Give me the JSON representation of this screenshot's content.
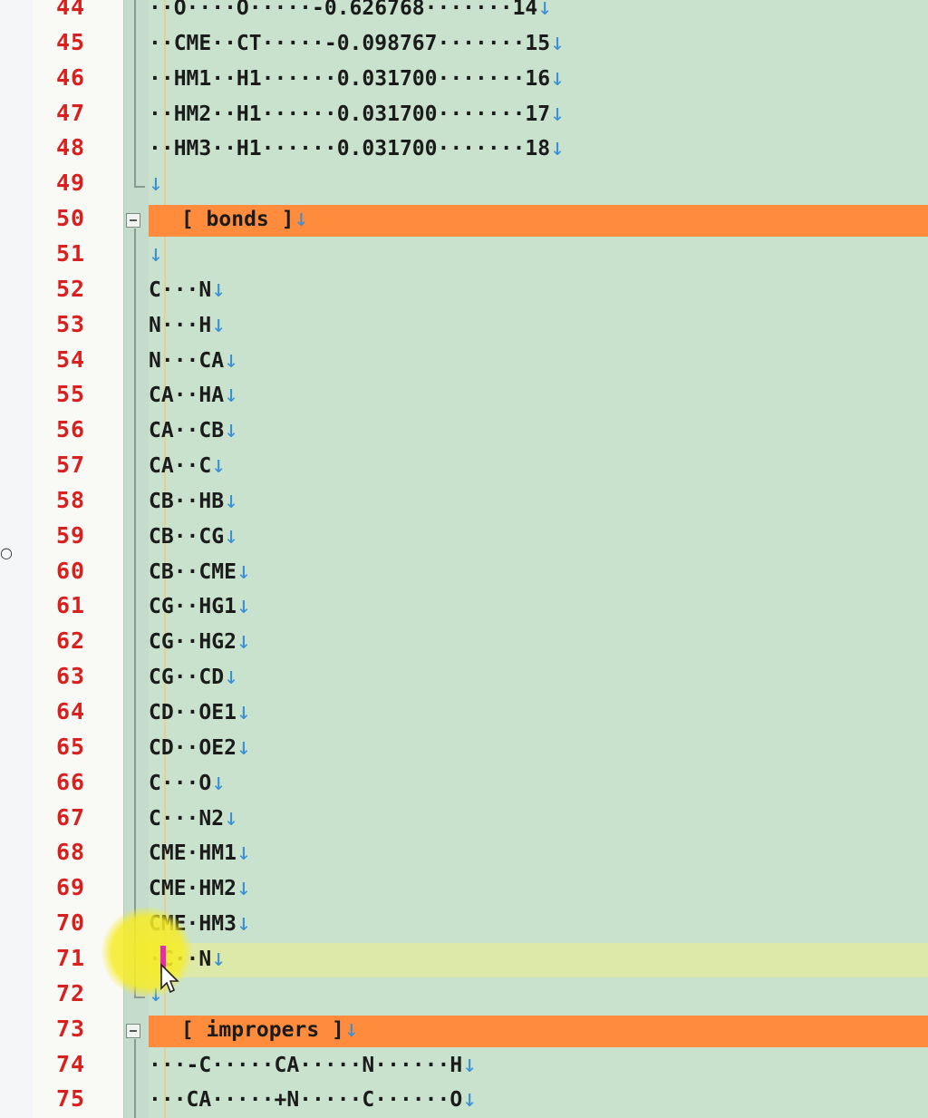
{
  "editor": {
    "colors": {
      "line_number": "#d8211f",
      "section_header_bg": "#ff8c3c",
      "text_bg": "#c9e2cd",
      "eol_arrow": "#3b8fd6",
      "current_line_bg": "#dde9a8"
    },
    "eol_marker": "↓",
    "current_line": "71",
    "lines": [
      {
        "num": "44",
        "text": "··O····O·····-0.626768·······14"
      },
      {
        "num": "45",
        "text": "··CME··CT·····-0.098767·······15"
      },
      {
        "num": "46",
        "text": "··HM1··H1······0.031700·······16"
      },
      {
        "num": "47",
        "text": "··HM2··H1······0.031700·······17"
      },
      {
        "num": "48",
        "text": "··HM3··H1······0.031700·······18"
      },
      {
        "num": "49",
        "text": ""
      },
      {
        "num": "50",
        "text": " [ bonds ]",
        "section": true
      },
      {
        "num": "51",
        "text": ""
      },
      {
        "num": "52",
        "text": "C···N"
      },
      {
        "num": "53",
        "text": "N···H"
      },
      {
        "num": "54",
        "text": "N···CA"
      },
      {
        "num": "55",
        "text": "CA··HA"
      },
      {
        "num": "56",
        "text": "CA··CB"
      },
      {
        "num": "57",
        "text": "CA··C"
      },
      {
        "num": "58",
        "text": "CB··HB"
      },
      {
        "num": "59",
        "text": "CB··CG"
      },
      {
        "num": "60",
        "text": "CB··CME"
      },
      {
        "num": "61",
        "text": "CG··HG1"
      },
      {
        "num": "62",
        "text": "CG··HG2"
      },
      {
        "num": "63",
        "text": "CG··CD"
      },
      {
        "num": "64",
        "text": "CD··OE1"
      },
      {
        "num": "65",
        "text": "CD··OE2"
      },
      {
        "num": "66",
        "text": "C···O"
      },
      {
        "num": "67",
        "text": "C···N2"
      },
      {
        "num": "68",
        "text": "CME·HM1"
      },
      {
        "num": "69",
        "text": "CME·HM2"
      },
      {
        "num": "70",
        "text": "CME·HM3"
      },
      {
        "num": "71",
        "text": "·C··N"
      },
      {
        "num": "72",
        "text": ""
      },
      {
        "num": "73",
        "text": " [ impropers ]",
        "section": true
      },
      {
        "num": "74",
        "text": "···-C·····CA·····N······H"
      },
      {
        "num": "75",
        "text": "···CA·····+N·····C······O"
      }
    ]
  }
}
